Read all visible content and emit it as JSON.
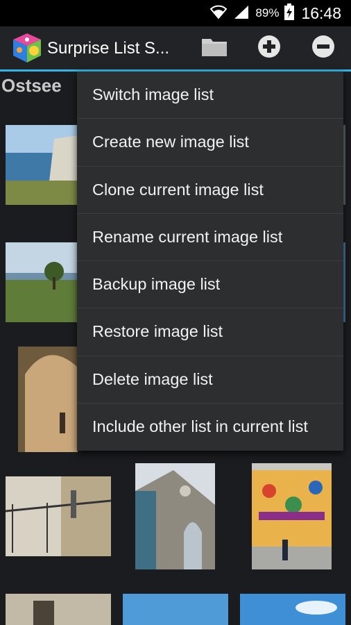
{
  "status_bar": {
    "battery_percent": "89%",
    "time": "16:48",
    "icons": [
      "wifi-icon",
      "signal-icon",
      "battery-charging-icon"
    ]
  },
  "action_bar": {
    "title": "Surprise List S...",
    "app_icon": "dice-cube-icon",
    "buttons": [
      "folder-icon",
      "add-circle-icon",
      "remove-circle-icon"
    ],
    "accent_color": "#33b5e5"
  },
  "content": {
    "list_name": "Ostsee"
  },
  "menu": {
    "items": [
      "Switch image list",
      "Create new image list",
      "Clone current image list",
      "Rename current image list",
      "Backup image list",
      "Restore image list",
      "Delete image list",
      "Include other list in current list"
    ]
  }
}
